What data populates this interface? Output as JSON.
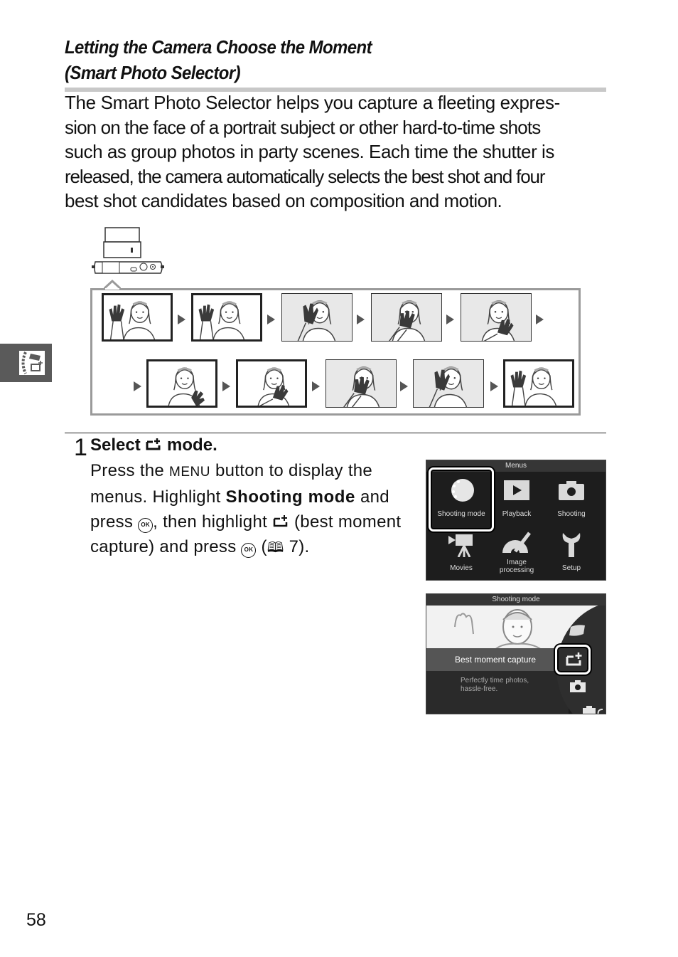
{
  "heading": {
    "line1": "Letting the Camera Choose the Moment",
    "line2": "(Smart Photo Selector)"
  },
  "intro": {
    "lines": [
      "The Smart Photo Selector helps you capture a fleeting expres-",
      "sion on the face of a portrait subject or other hard-to-time shots",
      "such as group photos in party scenes. Each time the shutter is",
      "released, the camera automatically selects the best shot and four",
      "best shot candidates based on composition and motion."
    ]
  },
  "illustration": {
    "camera_icon": "camera-top-view-icon",
    "sequence": {
      "row1": [
        {
          "type": "best",
          "pose": "wave"
        },
        {
          "type": "best",
          "pose": "wave"
        },
        {
          "type": "candidate",
          "pose": "hand-over-eye"
        },
        {
          "type": "candidate",
          "pose": "hand-over-mouth"
        },
        {
          "type": "candidate",
          "pose": "hand-at-chin"
        }
      ],
      "row2": [
        {
          "type": "best",
          "pose": "hand-at-shoulder"
        },
        {
          "type": "best",
          "pose": "hand-at-chin"
        },
        {
          "type": "candidate",
          "pose": "hand-over-mouth"
        },
        {
          "type": "candidate",
          "pose": "hand-over-eye"
        },
        {
          "type": "best",
          "pose": "wave"
        }
      ]
    }
  },
  "side_tab": {
    "icon": "shooting-mode-dial-icon"
  },
  "step": {
    "number": "1",
    "heading_pre": "Select ",
    "heading_post": " mode.",
    "body": {
      "t1": "Press the ",
      "menu_word": "MENU",
      "t2": " button to display the menus. Highlight ",
      "bold": "Shooting mode",
      "t3": " and press ",
      "ok": "OK",
      "t4": ", then highlight ",
      "t5": " (best moment capture) and press ",
      "t6": " (",
      "page_ref": " 7",
      "t7": ")."
    }
  },
  "screen_menus": {
    "title": "Menus",
    "items": [
      {
        "label": "Shooting mode",
        "icon": "mode-dial-icon",
        "selected": true
      },
      {
        "label": "Playback",
        "icon": "playback-icon",
        "selected": false
      },
      {
        "label": "Shooting",
        "icon": "camera-icon",
        "selected": false
      },
      {
        "label": "Movies",
        "icon": "movie-camera-icon",
        "selected": false
      },
      {
        "label_line1": "Image",
        "label_line2": "processing",
        "icon": "image-processing-icon",
        "selected": false
      },
      {
        "label": "Setup",
        "icon": "wrench-icon",
        "selected": false
      }
    ]
  },
  "screen_shooting_mode": {
    "title": "Shooting mode",
    "selected_label": "Best moment capture",
    "desc_line1": "Perfectly time photos,",
    "desc_line2": "hassle-free.",
    "wheel_icons": [
      "creative-mode-icon",
      "best-moment-capture-icon",
      "camera-icon",
      "smart-camera-icon"
    ]
  },
  "footer": {
    "page_number": "58"
  }
}
